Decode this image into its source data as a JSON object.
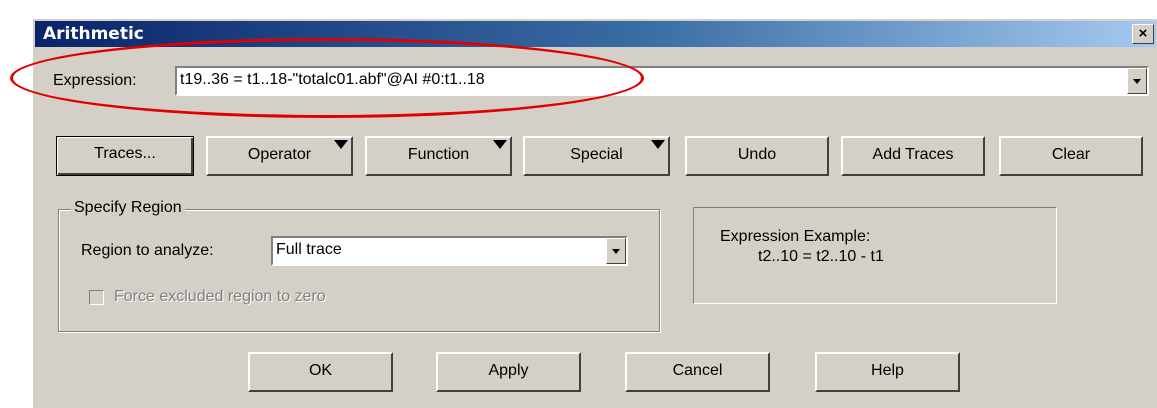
{
  "window": {
    "title": "Arithmetic",
    "close_glyph": "×"
  },
  "expression": {
    "label": "Expression:",
    "value": "t19..36 = t1..18-\"totalc01.abf\"@AI #0:t1..18"
  },
  "toolbar": {
    "traces": "Traces...",
    "operator": "Operator",
    "function": "Function",
    "special": "Special",
    "undo": "Undo",
    "add_traces": "Add Traces",
    "clear": "Clear"
  },
  "region": {
    "group_title": "Specify Region",
    "analyze_label": "Region to analyze:",
    "analyze_value": "Full trace",
    "force_zero_label": "Force excluded region to zero",
    "force_zero_checked": false
  },
  "example": {
    "title": "Expression Example:",
    "text": "t2..10 = t2..10 - t1"
  },
  "footer": {
    "ok": "OK",
    "apply": "Apply",
    "cancel": "Cancel",
    "help": "Help"
  },
  "colors": {
    "dialog_bg": "#d4d0c8",
    "title_bar": "#0a246a",
    "annotation_ellipse": "#e00000"
  }
}
